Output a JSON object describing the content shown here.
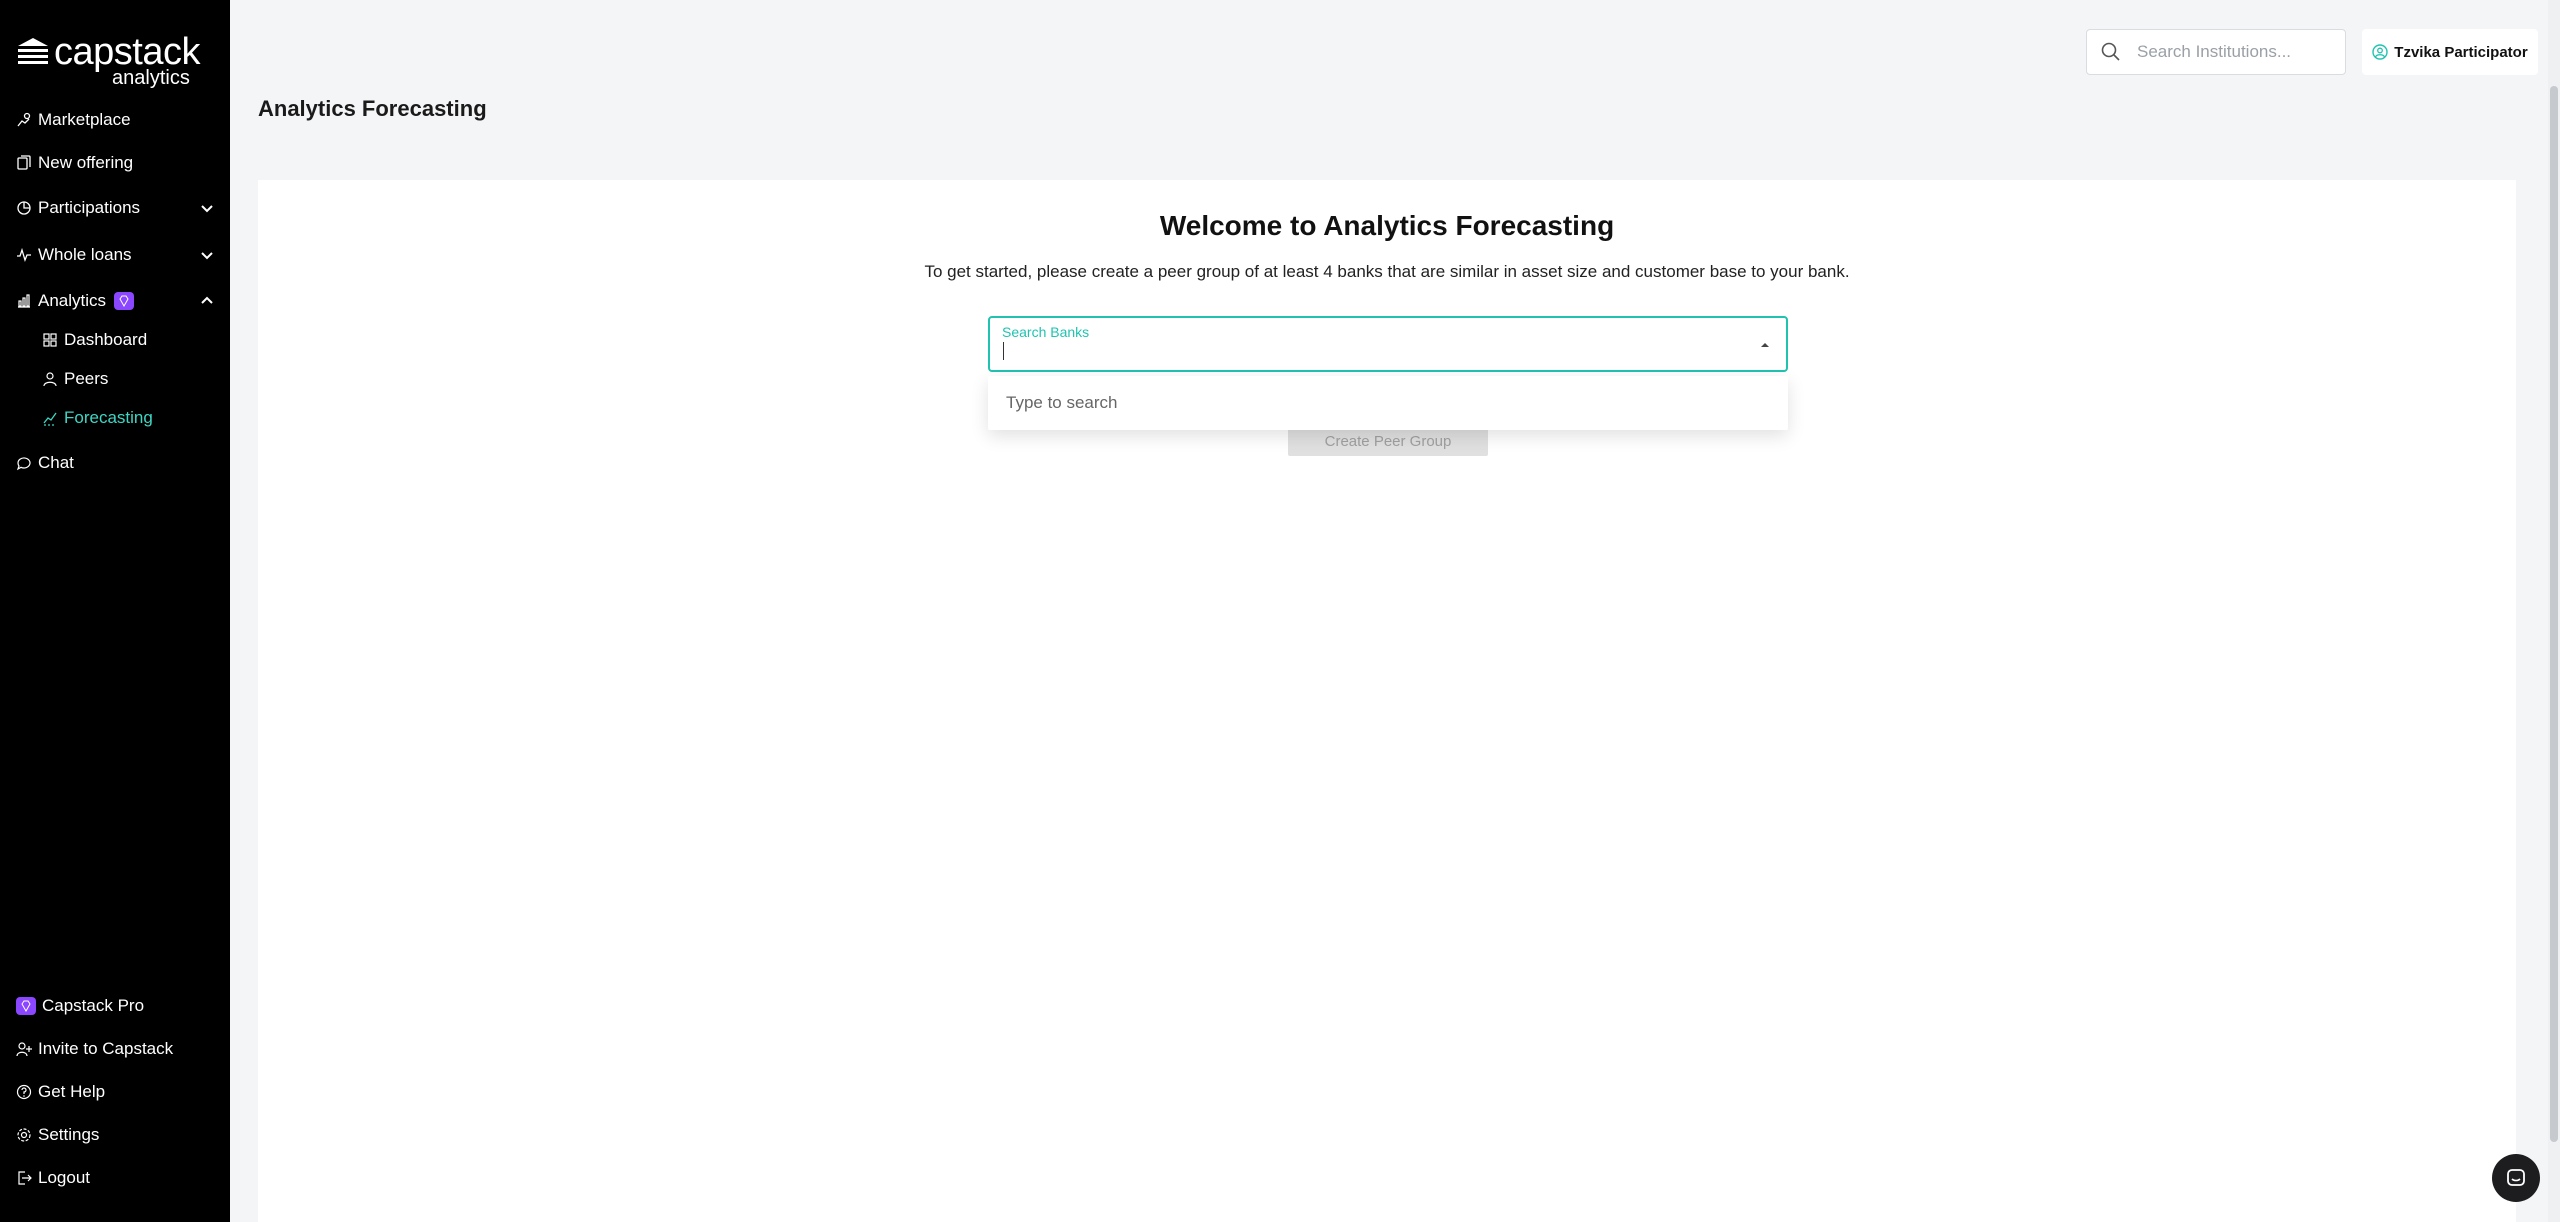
{
  "brand": {
    "name": "capstack",
    "sub": "analytics"
  },
  "sidebar": {
    "items": [
      {
        "label": "Marketplace",
        "icon": "marketplace-icon"
      },
      {
        "label": "New offering",
        "icon": "new-offering-icon"
      },
      {
        "label": "Participations",
        "icon": "pie-chart-icon"
      },
      {
        "label": "Whole loans",
        "icon": "whole-loans-icon"
      },
      {
        "label": "Analytics",
        "icon": "bar-chart-icon"
      },
      {
        "label": "Dashboard",
        "icon": "dashboard-icon"
      },
      {
        "label": "Peers",
        "icon": "person-icon"
      },
      {
        "label": "Forecasting",
        "icon": "trend-icon"
      },
      {
        "label": "Chat",
        "icon": "chat-bubble-icon"
      }
    ],
    "bottom": [
      {
        "label": "Capstack Pro",
        "icon": "pro-icon"
      },
      {
        "label": "Invite to Capstack",
        "icon": "invite-icon"
      },
      {
        "label": "Get Help",
        "icon": "help-icon"
      },
      {
        "label": "Settings",
        "icon": "gear-icon"
      },
      {
        "label": "Logout",
        "icon": "logout-icon"
      }
    ],
    "active": "Forecasting"
  },
  "header": {
    "search_placeholder": "Search Institutions...",
    "user_name": "Tzvika Participator"
  },
  "page": {
    "title": "Analytics Forecasting",
    "welcome": "Welcome to Analytics Forecasting",
    "intro": "To get started, please create a peer group of at least 4 banks that are similar in asset size and customer base to your bank.",
    "bank_search_label": "Search Banks",
    "dropdown_hint": "Type to search",
    "create_button": "Create Peer Group"
  },
  "colors": {
    "accent": "#20c3b0",
    "active_nav": "#3ed6c4",
    "pro": "#8b46ff",
    "sidebar_bg": "#000000"
  }
}
